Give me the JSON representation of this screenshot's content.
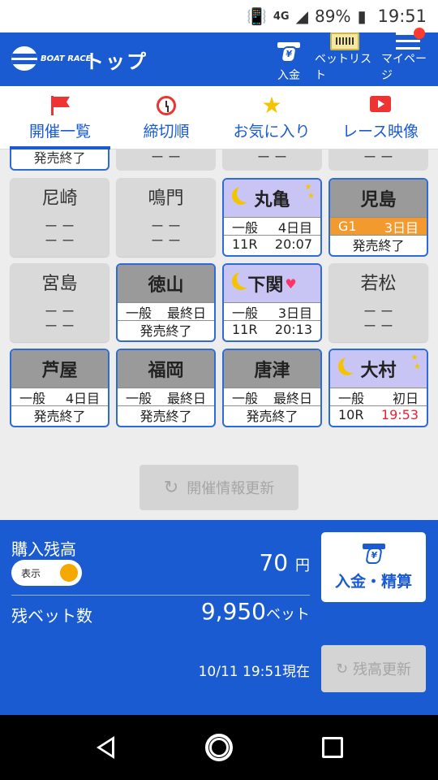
{
  "status_bar": {
    "network": "4G",
    "battery": "89%",
    "time": "19:51"
  },
  "app_bar": {
    "logo_text": "BOAT RACE",
    "title": "トップ",
    "deposit_label": "入金",
    "betlist_label": "ベットリスト",
    "mypage_label": "マイページ"
  },
  "tabs": [
    {
      "label": "開催一覧",
      "icon": "flag-icon",
      "active": true
    },
    {
      "label": "締切順",
      "icon": "alarm-clock-icon",
      "active": false
    },
    {
      "label": "お気に入り",
      "icon": "star-icon",
      "active": false
    },
    {
      "label": "レース映像",
      "icon": "video-icon",
      "active": false
    }
  ],
  "partial_row": {
    "c1": "発売終了",
    "c2": "ー ー",
    "c3": "ー ー",
    "c4": "ー ー"
  },
  "venues": [
    {
      "name": "尼崎",
      "line1": "ー ー",
      "line2": "ー ー"
    },
    {
      "name": "鳴門",
      "line1": "ー ー",
      "line2": "ー ー"
    },
    {
      "name": "丸亀",
      "grade": "一般",
      "day": "4日目",
      "race": "11R",
      "deadline": "20:07"
    },
    {
      "name": "児島",
      "grade": "G1",
      "day": "3日目",
      "status": "発売終了"
    },
    {
      "name": "宮島",
      "line1": "ー ー",
      "line2": "ー ー"
    },
    {
      "name": "徳山",
      "grade": "一般",
      "day": "最終日",
      "status": "発売終了"
    },
    {
      "name": "下関",
      "grade": "一般",
      "day": "3日目",
      "race": "11R",
      "deadline": "20:13"
    },
    {
      "name": "若松",
      "line1": "ー ー",
      "line2": "ー ー"
    },
    {
      "name": "芦屋",
      "grade": "一般",
      "day": "4日目",
      "status": "発売終了"
    },
    {
      "name": "福岡",
      "grade": "一般",
      "day": "最終日",
      "status": "発売終了"
    },
    {
      "name": "唐津",
      "grade": "一般",
      "day": "最終日",
      "status": "発売終了"
    },
    {
      "name": "大村",
      "grade": "一般",
      "day": "初日",
      "race": "10R",
      "deadline": "19:53"
    }
  ],
  "refresh_button": "開催情報更新",
  "account": {
    "balance_label": "購入残高",
    "toggle_label": "表示",
    "balance_value": "70",
    "balance_unit": "円",
    "bets_label": "残ベット数",
    "bets_value": "9,950",
    "bets_unit": "ベット",
    "deposit_button": "入金・精算",
    "as_of": "10/11 19:51現在",
    "update_button": "残高更新"
  },
  "colors": {
    "brand": "#1a5bd1",
    "accent_orange": "#f39a2e",
    "deadline_red": "#e8203a",
    "night_header": "#c8c5f5"
  }
}
